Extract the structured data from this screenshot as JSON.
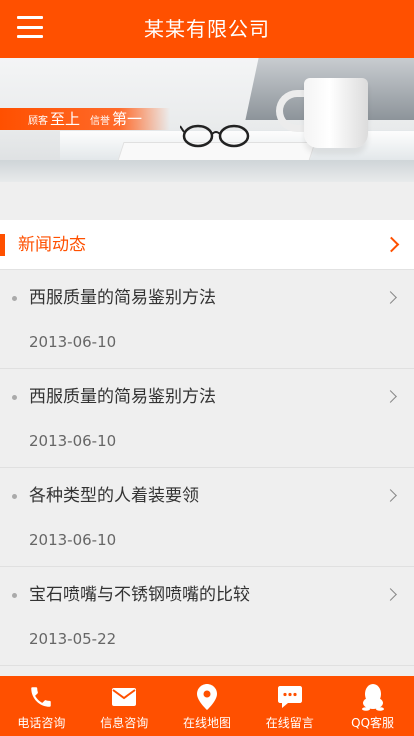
{
  "header": {
    "title": "某某有限公司",
    "menu_icon": "hamburger-menu-icon"
  },
  "banner": {
    "slogan": {
      "part1_small": "顾客",
      "part1_big": "至上",
      "part2_small": "信誉",
      "part2_big": "第一"
    }
  },
  "news": {
    "heading": "新闻动态",
    "items": [
      {
        "title": "西服质量的简易鉴别方法",
        "date": "2013-06-10"
      },
      {
        "title": "西服质量的简易鉴别方法",
        "date": "2013-06-10"
      },
      {
        "title": "各种类型的人着装要领",
        "date": "2013-06-10"
      },
      {
        "title": "宝石喷嘴与不锈钢喷嘴的比较",
        "date": "2013-05-22"
      }
    ]
  },
  "bottom_nav": {
    "items": [
      {
        "label": "电话咨询",
        "icon": "phone-icon"
      },
      {
        "label": "信息咨询",
        "icon": "envelope-icon"
      },
      {
        "label": "在线地图",
        "icon": "map-pin-icon"
      },
      {
        "label": "在线留言",
        "icon": "chat-bubble-icon"
      },
      {
        "label": "QQ客服",
        "icon": "qq-penguin-icon"
      }
    ]
  },
  "colors": {
    "brand": "#ff5000",
    "background": "#efefef",
    "text": "#333333",
    "muted": "#666666"
  }
}
